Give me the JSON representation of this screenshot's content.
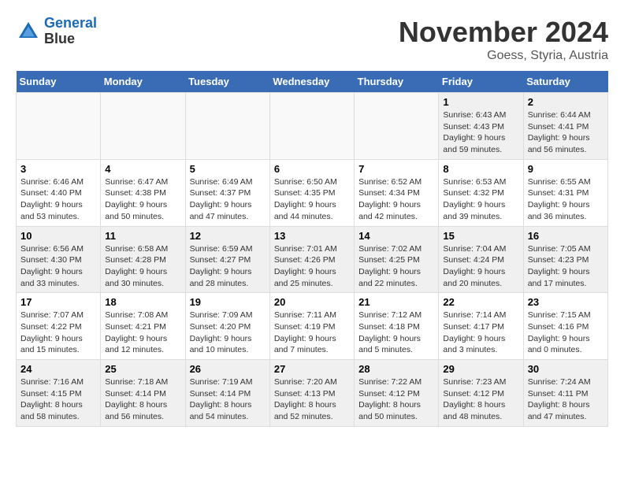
{
  "header": {
    "logo_line1": "General",
    "logo_line2": "Blue",
    "title": "November 2024",
    "subtitle": "Goess, Styria, Austria"
  },
  "calendar": {
    "days_of_week": [
      "Sunday",
      "Monday",
      "Tuesday",
      "Wednesday",
      "Thursday",
      "Friday",
      "Saturday"
    ],
    "weeks": [
      [
        {
          "day": "",
          "info": ""
        },
        {
          "day": "",
          "info": ""
        },
        {
          "day": "",
          "info": ""
        },
        {
          "day": "",
          "info": ""
        },
        {
          "day": "",
          "info": ""
        },
        {
          "day": "1",
          "info": "Sunrise: 6:43 AM\nSunset: 4:43 PM\nDaylight: 9 hours and 59 minutes."
        },
        {
          "day": "2",
          "info": "Sunrise: 6:44 AM\nSunset: 4:41 PM\nDaylight: 9 hours and 56 minutes."
        }
      ],
      [
        {
          "day": "3",
          "info": "Sunrise: 6:46 AM\nSunset: 4:40 PM\nDaylight: 9 hours and 53 minutes."
        },
        {
          "day": "4",
          "info": "Sunrise: 6:47 AM\nSunset: 4:38 PM\nDaylight: 9 hours and 50 minutes."
        },
        {
          "day": "5",
          "info": "Sunrise: 6:49 AM\nSunset: 4:37 PM\nDaylight: 9 hours and 47 minutes."
        },
        {
          "day": "6",
          "info": "Sunrise: 6:50 AM\nSunset: 4:35 PM\nDaylight: 9 hours and 44 minutes."
        },
        {
          "day": "7",
          "info": "Sunrise: 6:52 AM\nSunset: 4:34 PM\nDaylight: 9 hours and 42 minutes."
        },
        {
          "day": "8",
          "info": "Sunrise: 6:53 AM\nSunset: 4:32 PM\nDaylight: 9 hours and 39 minutes."
        },
        {
          "day": "9",
          "info": "Sunrise: 6:55 AM\nSunset: 4:31 PM\nDaylight: 9 hours and 36 minutes."
        }
      ],
      [
        {
          "day": "10",
          "info": "Sunrise: 6:56 AM\nSunset: 4:30 PM\nDaylight: 9 hours and 33 minutes."
        },
        {
          "day": "11",
          "info": "Sunrise: 6:58 AM\nSunset: 4:28 PM\nDaylight: 9 hours and 30 minutes."
        },
        {
          "day": "12",
          "info": "Sunrise: 6:59 AM\nSunset: 4:27 PM\nDaylight: 9 hours and 28 minutes."
        },
        {
          "day": "13",
          "info": "Sunrise: 7:01 AM\nSunset: 4:26 PM\nDaylight: 9 hours and 25 minutes."
        },
        {
          "day": "14",
          "info": "Sunrise: 7:02 AM\nSunset: 4:25 PM\nDaylight: 9 hours and 22 minutes."
        },
        {
          "day": "15",
          "info": "Sunrise: 7:04 AM\nSunset: 4:24 PM\nDaylight: 9 hours and 20 minutes."
        },
        {
          "day": "16",
          "info": "Sunrise: 7:05 AM\nSunset: 4:23 PM\nDaylight: 9 hours and 17 minutes."
        }
      ],
      [
        {
          "day": "17",
          "info": "Sunrise: 7:07 AM\nSunset: 4:22 PM\nDaylight: 9 hours and 15 minutes."
        },
        {
          "day": "18",
          "info": "Sunrise: 7:08 AM\nSunset: 4:21 PM\nDaylight: 9 hours and 12 minutes."
        },
        {
          "day": "19",
          "info": "Sunrise: 7:09 AM\nSunset: 4:20 PM\nDaylight: 9 hours and 10 minutes."
        },
        {
          "day": "20",
          "info": "Sunrise: 7:11 AM\nSunset: 4:19 PM\nDaylight: 9 hours and 7 minutes."
        },
        {
          "day": "21",
          "info": "Sunrise: 7:12 AM\nSunset: 4:18 PM\nDaylight: 9 hours and 5 minutes."
        },
        {
          "day": "22",
          "info": "Sunrise: 7:14 AM\nSunset: 4:17 PM\nDaylight: 9 hours and 3 minutes."
        },
        {
          "day": "23",
          "info": "Sunrise: 7:15 AM\nSunset: 4:16 PM\nDaylight: 9 hours and 0 minutes."
        }
      ],
      [
        {
          "day": "24",
          "info": "Sunrise: 7:16 AM\nSunset: 4:15 PM\nDaylight: 8 hours and 58 minutes."
        },
        {
          "day": "25",
          "info": "Sunrise: 7:18 AM\nSunset: 4:14 PM\nDaylight: 8 hours and 56 minutes."
        },
        {
          "day": "26",
          "info": "Sunrise: 7:19 AM\nSunset: 4:14 PM\nDaylight: 8 hours and 54 minutes."
        },
        {
          "day": "27",
          "info": "Sunrise: 7:20 AM\nSunset: 4:13 PM\nDaylight: 8 hours and 52 minutes."
        },
        {
          "day": "28",
          "info": "Sunrise: 7:22 AM\nSunset: 4:12 PM\nDaylight: 8 hours and 50 minutes."
        },
        {
          "day": "29",
          "info": "Sunrise: 7:23 AM\nSunset: 4:12 PM\nDaylight: 8 hours and 48 minutes."
        },
        {
          "day": "30",
          "info": "Sunrise: 7:24 AM\nSunset: 4:11 PM\nDaylight: 8 hours and 47 minutes."
        }
      ]
    ]
  }
}
